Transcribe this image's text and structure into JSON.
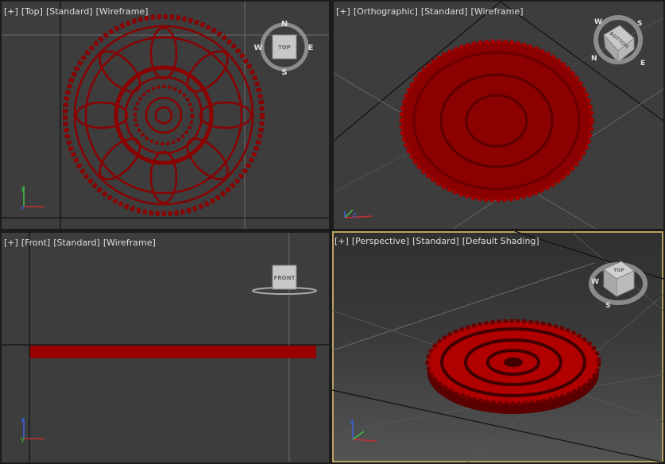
{
  "viewports": {
    "top": {
      "labels": [
        "[+]",
        "[Top]",
        "[Standard]",
        "[Wireframe]"
      ],
      "viewcube": {
        "face": "TOP",
        "compass": {
          "n": "N",
          "s": "S",
          "e": "E",
          "w": "W"
        }
      }
    },
    "ortho": {
      "labels": [
        "[+]",
        "[Orthographic]",
        "[Standard]",
        "[Wireframe]"
      ],
      "viewcube": {
        "face": "BOTTOM",
        "compass": {
          "s": "S",
          "e": "E",
          "w": "W",
          "n": "N"
        }
      }
    },
    "front": {
      "labels": [
        "[+]",
        "[Front]",
        "[Standard]",
        "[Wireframe]"
      ],
      "viewcube": {
        "face": "FRONT"
      }
    },
    "persp": {
      "labels": [
        "[+]",
        "[Perspective]",
        "[Standard]",
        "[Default Shading]"
      ],
      "viewcube": {
        "face": "TOP",
        "compass": {
          "w": "W",
          "s": "S"
        }
      }
    }
  },
  "axes": {
    "x": "x",
    "y": "y",
    "z": "z"
  },
  "colors": {
    "object": "#8b0000",
    "viewport_bg": "#3d3d3d",
    "active_border": "#b8a25e",
    "axis_x": "#c03030",
    "axis_y": "#40c040",
    "axis_z": "#4060e0"
  }
}
